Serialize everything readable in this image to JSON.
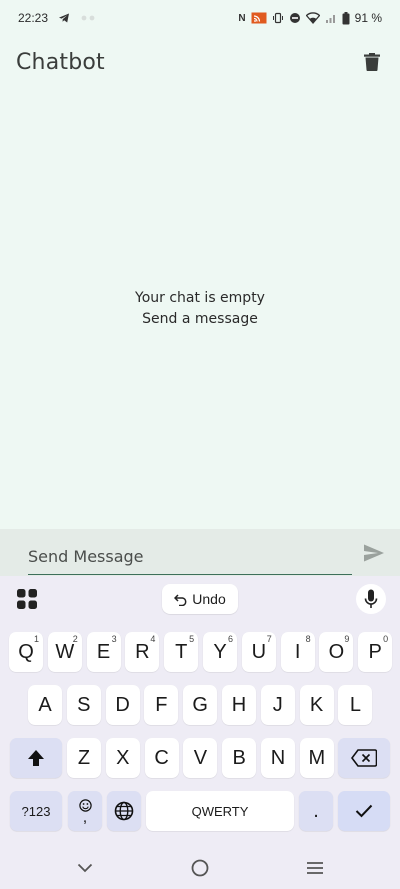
{
  "status_bar": {
    "time": "22:23",
    "battery": "91 %"
  },
  "app_bar": {
    "title": "Chatbot",
    "delete_icon": "trash-icon"
  },
  "empty_state": {
    "line1": "Your chat is empty",
    "line2": "Send a message"
  },
  "composer": {
    "placeholder": "Send Message",
    "send_icon": "send-icon"
  },
  "keyboard": {
    "undo_label": "Undo",
    "rows": [
      [
        {
          "l": "Q",
          "h": "1"
        },
        {
          "l": "W",
          "h": "2"
        },
        {
          "l": "E",
          "h": "3"
        },
        {
          "l": "R",
          "h": "4"
        },
        {
          "l": "T",
          "h": "5"
        },
        {
          "l": "Y",
          "h": "6"
        },
        {
          "l": "U",
          "h": "7"
        },
        {
          "l": "I",
          "h": "8"
        },
        {
          "l": "O",
          "h": "9"
        },
        {
          "l": "P",
          "h": "0"
        }
      ],
      [
        {
          "l": "A"
        },
        {
          "l": "S"
        },
        {
          "l": "D"
        },
        {
          "l": "F"
        },
        {
          "l": "G"
        },
        {
          "l": "H"
        },
        {
          "l": "J"
        },
        {
          "l": "K"
        },
        {
          "l": "L"
        }
      ],
      [
        {
          "l": "Z"
        },
        {
          "l": "X"
        },
        {
          "l": "C"
        },
        {
          "l": "V"
        },
        {
          "l": "B"
        },
        {
          "l": "N"
        },
        {
          "l": "M"
        }
      ]
    ],
    "symbols_label": "?123",
    "space_label": "QWERTY",
    "comma_label": ",",
    "period_label": "."
  },
  "colors": {
    "background": "#eef8f3",
    "composer": "#e4ebe7",
    "keyboard": "#eeecf5",
    "accent": "#3d6f5a"
  }
}
